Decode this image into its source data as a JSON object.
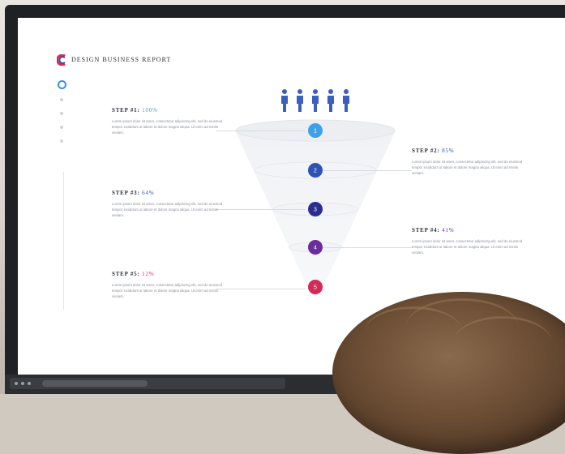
{
  "brand": {
    "title": "DESIGN BUSINESS REPORT"
  },
  "steps": [
    {
      "label": "STEP #1:",
      "percent": "100%",
      "number": "1",
      "color": "#3fa0e8",
      "text": "Lorem ipsum dolor sit amet, consectetur adipiscing elit, sed do eiusmod tempor incididunt ut labore et dolore magna aliqua. Ut enim ad minim veniam."
    },
    {
      "label": "STEP #2:",
      "percent": "85%",
      "number": "2",
      "color": "#2e53b5",
      "text": "Lorem ipsum dolor sit amet, consectetur adipiscing elit, sed do eiusmod tempor incididunt ut labore et dolore magna aliqua. Ut enim ad minim veniam."
    },
    {
      "label": "STEP #3:",
      "percent": "64%",
      "number": "3",
      "color": "#2a2f8f",
      "text": "Lorem ipsum dolor sit amet, consectetur adipiscing elit, sed do eiusmod tempor incididunt ut labore et dolore magna aliqua. Ut enim ad minim veniam."
    },
    {
      "label": "STEP #4:",
      "percent": "41%",
      "number": "4",
      "color": "#6b2c9c",
      "text": "Lorem ipsum dolor sit amet, consectetur adipiscing elit, sed do eiusmod tempor incididunt ut labore et dolore magna aliqua. Ut enim ad minim veniam."
    },
    {
      "label": "STEP #5:",
      "percent": "12%",
      "number": "5",
      "color": "#d42a5a",
      "text": "Lorem ipsum dolor sit amet, consectetur adipiscing elit, sed do eiusmod tempor incididunt ut labore et dolore magna aliqua. Ut enim ad minim veniam."
    }
  ],
  "colors": {
    "person": "#3a5fc0",
    "logo_red": "#e0294f",
    "logo_blue": "#2e53b5",
    "nav_active": "#3a8ee6"
  },
  "icons": [
    "person-icon",
    "logo-icon"
  ]
}
